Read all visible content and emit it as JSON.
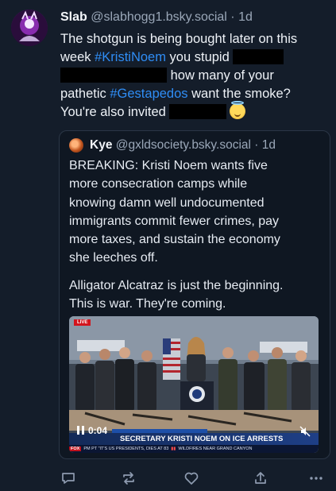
{
  "post": {
    "author": "Slab",
    "handle": "@slabhogg1.bsky.social",
    "separator": "·",
    "time": "1d",
    "text": {
      "line1": "The shotgun is being bought later on this",
      "line2_a": "week ",
      "line2_tag": "#KristiNoem",
      "line2_b": " you stupid",
      "line3": "how many of your",
      "line4_a": "pathetic ",
      "line4_tag": "#Gestapedos",
      "line4_b": " want the smoke?",
      "line5": "You're also invited"
    }
  },
  "quote": {
    "author": "Kye",
    "handle": "@gxldsociety.bsky.social",
    "separator": "·",
    "time": "1d",
    "text_lines": [
      "BREAKING: Kristi Noem wants five",
      "more consecration camps while",
      "knowing damn well undocumented",
      "immigrants commit fewer crimes, pay",
      "more taxes, and sustain the economy",
      "she leeches off."
    ],
    "text2_lines": [
      "Alligator Alcatraz is just the beginning.",
      "This is war. They're coming."
    ],
    "video": {
      "time": "0:04",
      "headline": "SECRETARY KRISTI NOEM ON ICE ARRESTS",
      "ticker_brand": "FOX",
      "ticker_a": "PM PT",
      "ticker_b": "\"IT'S US PRESIDENTS, DIES AT 83",
      "ticker_c": "WILDFIRES NEAR GRAND CANYON",
      "live_label": "LIVE"
    }
  },
  "actions": [
    "reply-icon",
    "repost-icon",
    "like-icon",
    "share-icon",
    "more-icon"
  ],
  "colors": {
    "background": "#141d2a",
    "hashtag": "#2f8df5",
    "muted": "#9aa7b8"
  }
}
